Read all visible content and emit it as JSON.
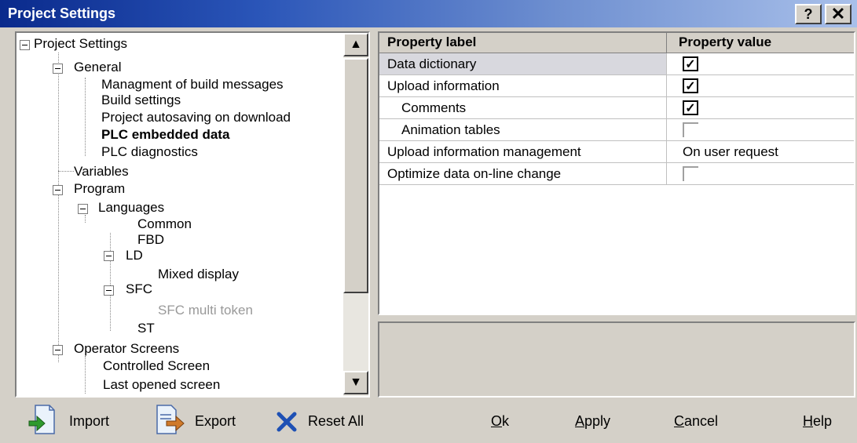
{
  "window": {
    "title": "Project Settings",
    "help_label": "?",
    "close_label": "✕"
  },
  "tree": {
    "nodes": [
      "Project Settings",
      "General",
      "Managment of build messages",
      "Build settings",
      "Project autosaving on download",
      "PLC embedded data",
      "PLC diagnostics",
      "Variables",
      "Program",
      "Languages",
      "Common",
      "FBD",
      "LD",
      "Mixed display",
      "SFC",
      "SFC multi token",
      "ST",
      "Operator Screens",
      "Controlled Screen",
      "Last opened screen"
    ],
    "scroll_up": "▲",
    "scroll_down": "▼"
  },
  "properties": {
    "header_label": "Property label",
    "header_value": "Property value",
    "rows": [
      {
        "label": "Data dictionary",
        "checked": true
      },
      {
        "label": "Upload information",
        "checked": true
      },
      {
        "label": "Comments",
        "checked": true
      },
      {
        "label": "Animation tables",
        "checked": false
      },
      {
        "label": "Upload information management",
        "value": "On user request"
      },
      {
        "label": "Optimize data on-line change",
        "checked": false
      }
    ],
    "check_mark": "✓"
  },
  "buttons": {
    "import": "Import",
    "export": "Export",
    "reset_all": "Reset All",
    "ok_u": "O",
    "ok_rest": "k",
    "apply_u": "A",
    "apply_rest": "pply",
    "cancel_u": "C",
    "cancel_rest": "ancel",
    "help_u": "H",
    "help_rest": "elp"
  },
  "icons": {
    "import": "import-icon",
    "export": "export-icon",
    "reset": "x-icon"
  },
  "colors": {
    "title_start": "#0a2a8c",
    "title_end": "#a9c0ea",
    "reset_x": "#1e50b4",
    "import_arrow": "#2e9a2e",
    "export_arrow": "#d07a2a"
  }
}
